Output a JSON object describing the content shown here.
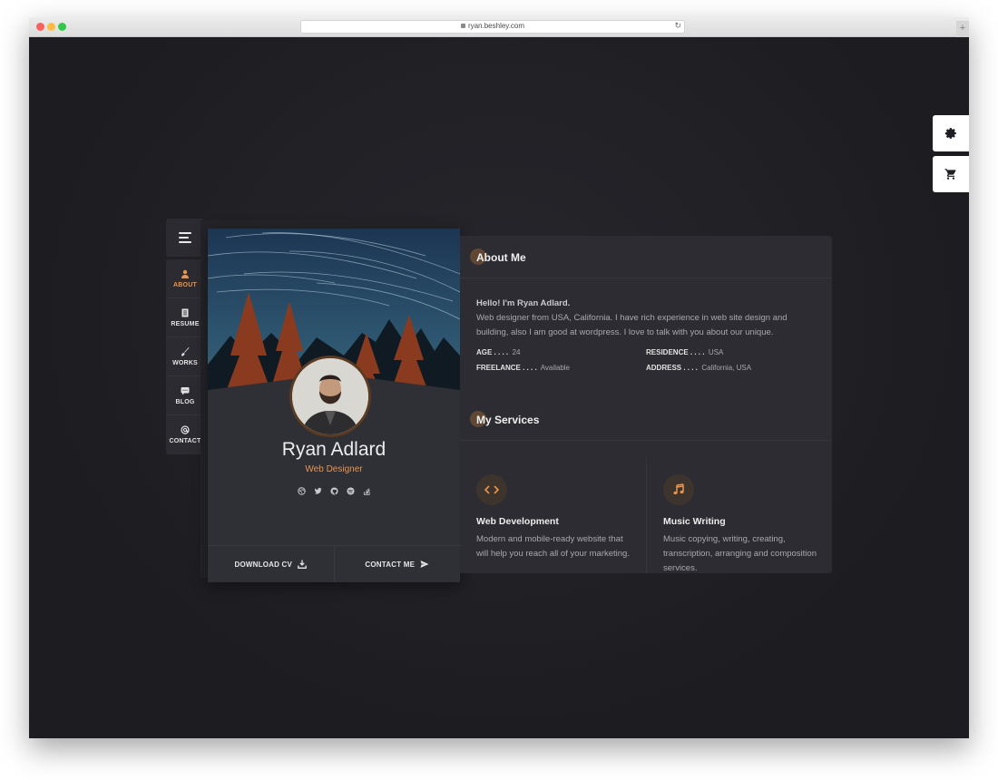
{
  "browser": {
    "url": "ryan.beshley.com",
    "newtab": "+"
  },
  "nav": {
    "items": [
      {
        "label": "ABOUT",
        "icon": "user-icon",
        "active": true
      },
      {
        "label": "RESUME",
        "icon": "document-icon",
        "active": false
      },
      {
        "label": "WORKS",
        "icon": "brush-icon",
        "active": false
      },
      {
        "label": "BLOG",
        "icon": "chat-icon",
        "active": false
      },
      {
        "label": "CONTACT",
        "icon": "at-icon",
        "active": false
      }
    ]
  },
  "profile": {
    "name": "Ryan Adlard",
    "role": "Web Designer",
    "social": [
      "dribbble-icon",
      "twitter-icon",
      "github-icon",
      "spotify-icon",
      "stackoverflow-icon"
    ],
    "download_label": "DOWNLOAD CV",
    "contact_label": "CONTACT ME"
  },
  "about": {
    "title": "About Me",
    "greeting": "Hello! I'm Ryan Adlard.",
    "bio": "Web designer from USA, California. I have rich experience in web site design and building, also I am good at wordpress. I love to talk with you about our unique.",
    "info": [
      {
        "key": "AGE . . . .",
        "value": "24"
      },
      {
        "key": "RESIDENCE . . . .",
        "value": "USA"
      },
      {
        "key": "FREELANCE . . . .",
        "value": "Available"
      },
      {
        "key": "ADDRESS . . . .",
        "value": "California, USA"
      }
    ]
  },
  "services": {
    "title": "My Services",
    "items": [
      {
        "title": "Web Development",
        "icon": "code-icon",
        "desc": "Modern and mobile-ready website that will help you reach all of your marketing."
      },
      {
        "title": "Music Writing",
        "icon": "music-icon",
        "desc": "Music copying, writing, creating, transcription, arranging and composition services."
      }
    ]
  },
  "colors": {
    "accent": "#e9964f",
    "bg": "#1e1e23",
    "panel": "#2c2c32"
  }
}
